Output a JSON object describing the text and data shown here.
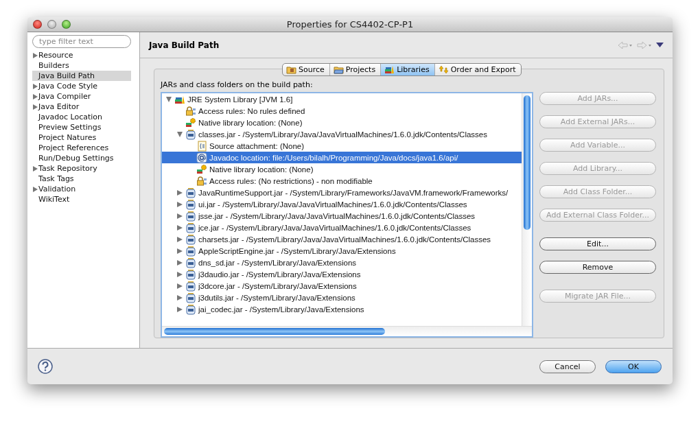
{
  "window": {
    "title": "Properties for CS4402-CP-P1"
  },
  "sidebar": {
    "filter": {
      "placeholder": "type filter text"
    },
    "items": [
      {
        "label": "Resource",
        "expanded": false,
        "selected": false
      },
      {
        "label": "Builders",
        "selected": false
      },
      {
        "label": "Java Build Path",
        "selected": true
      },
      {
        "label": "Java Code Style",
        "expanded": false,
        "selected": false
      },
      {
        "label": "Java Compiler",
        "expanded": false,
        "selected": false
      },
      {
        "label": "Java Editor",
        "expanded": false,
        "selected": false
      },
      {
        "label": "Javadoc Location",
        "selected": false
      },
      {
        "label": "Preview Settings",
        "selected": false
      },
      {
        "label": "Project Natures",
        "selected": false
      },
      {
        "label": "Project References",
        "selected": false
      },
      {
        "label": "Run/Debug Settings",
        "selected": false
      },
      {
        "label": "Task Repository",
        "expanded": false,
        "selected": false
      },
      {
        "label": "Task Tags",
        "selected": false
      },
      {
        "label": "Validation",
        "expanded": false,
        "selected": false
      },
      {
        "label": "WikiText",
        "selected": false
      }
    ]
  },
  "page": {
    "title": "Java Build Path",
    "tabs": [
      {
        "label": "Source",
        "kind": "source",
        "selected": false
      },
      {
        "label": "Projects",
        "kind": "projects",
        "selected": false
      },
      {
        "label": "Libraries",
        "kind": "libraries",
        "selected": true
      },
      {
        "label": "Order and Export",
        "kind": "order",
        "selected": false
      }
    ],
    "tree_label": "JARs and class folders on the build path:",
    "tree": [
      {
        "label": "JRE System Library [JVM 1.6]",
        "kind": "library",
        "expanded": true,
        "selected": false,
        "children": [
          {
            "label": "Access rules: No rules defined",
            "kind": "rules",
            "selected": false
          },
          {
            "label": "Native library location: (None)",
            "kind": "native",
            "selected": false
          },
          {
            "label": "classes.jar - /System/Library/Java/JavaVirtualMachines/1.6.0.jdk/Contents/Classes",
            "kind": "jar",
            "expanded": true,
            "selected": false,
            "children": [
              {
                "label": "Source attachment: (None)",
                "kind": "source",
                "selected": false
              },
              {
                "label": "Javadoc location: file:/Users/bilalh/Programming/Java/docs/java1.6/api/",
                "kind": "javadoc",
                "selected": true
              },
              {
                "label": "Native library location: (None)",
                "kind": "native",
                "selected": false
              },
              {
                "label": "Access rules: (No restrictions) - non modifiable",
                "kind": "rules",
                "selected": false
              }
            ]
          },
          {
            "label": "JavaRuntimeSupport.jar - /System/Library/Frameworks/JavaVM.framework/Frameworks/",
            "kind": "jar",
            "expanded": false,
            "selected": false
          },
          {
            "label": "ui.jar - /System/Library/Java/JavaVirtualMachines/1.6.0.jdk/Contents/Classes",
            "kind": "jar",
            "expanded": false,
            "selected": false
          },
          {
            "label": "jsse.jar - /System/Library/Java/JavaVirtualMachines/1.6.0.jdk/Contents/Classes",
            "kind": "jar",
            "expanded": false,
            "selected": false
          },
          {
            "label": "jce.jar - /System/Library/Java/JavaVirtualMachines/1.6.0.jdk/Contents/Classes",
            "kind": "jar",
            "expanded": false,
            "selected": false
          },
          {
            "label": "charsets.jar - /System/Library/Java/JavaVirtualMachines/1.6.0.jdk/Contents/Classes",
            "kind": "jar",
            "expanded": false,
            "selected": false
          },
          {
            "label": "AppleScriptEngine.jar - /System/Library/Java/Extensions",
            "kind": "jar",
            "expanded": false,
            "selected": false
          },
          {
            "label": "dns_sd.jar - /System/Library/Java/Extensions",
            "kind": "jar",
            "expanded": false,
            "selected": false
          },
          {
            "label": "j3daudio.jar - /System/Library/Java/Extensions",
            "kind": "jar",
            "expanded": false,
            "selected": false
          },
          {
            "label": "j3dcore.jar - /System/Library/Java/Extensions",
            "kind": "jar",
            "expanded": false,
            "selected": false
          },
          {
            "label": "j3dutils.jar - /System/Library/Java/Extensions",
            "kind": "jar",
            "expanded": false,
            "selected": false
          },
          {
            "label": "jai_codec.jar - /System/Library/Java/Extensions",
            "kind": "jar",
            "expanded": false,
            "selected": false
          }
        ]
      }
    ],
    "buttons": [
      {
        "label": "Add JARs...",
        "disabled": true
      },
      {
        "label": "Add External JARs...",
        "disabled": true
      },
      {
        "label": "Add Variable...",
        "disabled": true
      },
      {
        "label": "Add Library...",
        "disabled": true
      },
      {
        "label": "Add Class Folder...",
        "disabled": true
      },
      {
        "label": "Add External Class Folder...",
        "disabled": true
      },
      {
        "label": "Edit...",
        "disabled": false,
        "gap": true
      },
      {
        "label": "Remove",
        "disabled": false
      },
      {
        "label": "Migrate JAR File...",
        "disabled": true,
        "gap": true
      }
    ]
  },
  "footer": {
    "buttons": [
      {
        "label": "Cancel",
        "default": false
      },
      {
        "label": "OK",
        "default": true
      }
    ]
  }
}
